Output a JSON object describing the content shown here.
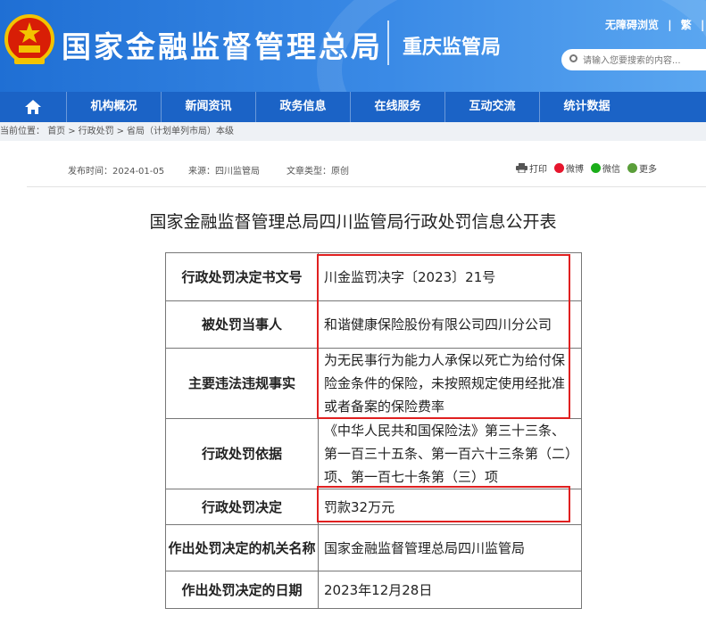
{
  "header": {
    "site_title": "国家金融监督管理总局",
    "sub_title": "重庆监管局",
    "links": [
      "无障碍浏览",
      "繁"
    ],
    "search_placeholder": "请输入您要搜索的内容..."
  },
  "nav": {
    "home_icon": "home-icon",
    "items": [
      "机构概况",
      "新闻资讯",
      "政务信息",
      "在线服务",
      "互动交流",
      "统计数据"
    ]
  },
  "breadcrumb": {
    "prefix": "当前位置：",
    "items": [
      "首页",
      "行政处罚",
      "省局（计划单列市局）本级"
    ]
  },
  "meta": {
    "publish_time": "发布时间：2024-01-05",
    "source": "来源：四川监管局",
    "category": "文章类型：原创"
  },
  "share": {
    "print": "打印",
    "weibo": "微博",
    "wechat": "微信",
    "more": "更多"
  },
  "doc_title": "国家金融监督管理总局四川监管局行政处罚信息公开表",
  "table": {
    "rows": [
      {
        "label": "行政处罚决定书文号",
        "value": "川金监罚决字〔2023〕21号"
      },
      {
        "label": "被处罚当事人",
        "value": "和谐健康保险股份有限公司四川分公司"
      },
      {
        "label": "主要违法违规事实",
        "value": "为无民事行为能力人承保以死亡为给付保险金条件的保险，未按照规定使用经批准或者备案的保险费率"
      },
      {
        "label": "行政处罚依据",
        "value": "《中华人民共和国保险法》第三十三条、第一百三十五条、第一百六十三条第（二）项、第一百七十条第（三）项"
      },
      {
        "label": "行政处罚决定",
        "value": "罚款32万元"
      },
      {
        "label": "作出处罚决定的机关名称",
        "value": "国家金融监督管理总局四川监管局"
      },
      {
        "label": "作出处罚决定的日期",
        "value": "2023年12月28日"
      }
    ]
  },
  "colors": {
    "header_blue": "#2f7fe0",
    "nav_blue": "#1b63c6",
    "highlight_red": "#e02020"
  }
}
